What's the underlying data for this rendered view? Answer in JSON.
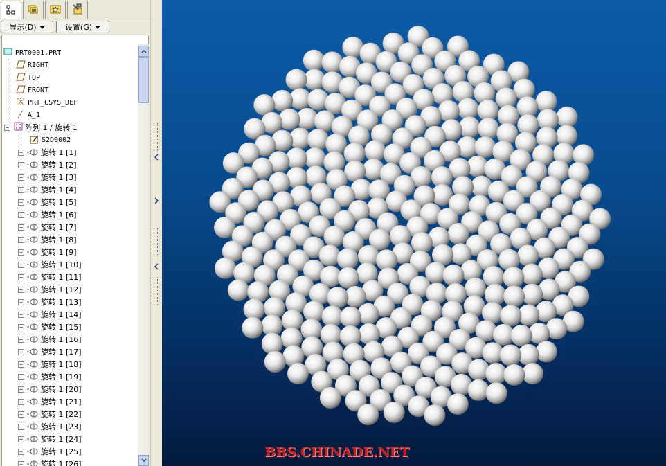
{
  "panel": {
    "tabs": [
      {
        "icon": "model-tree-icon",
        "active": true
      },
      {
        "icon": "folder-browser-icon",
        "active": false
      },
      {
        "icon": "favorites-icon",
        "active": false
      },
      {
        "icon": "connections-icon",
        "active": false
      }
    ],
    "show_menu": "显示(D)",
    "settings_menu": "设置(G)"
  },
  "tree": {
    "root": "PRT0001.PRT",
    "features": [
      {
        "label": "RIGHT",
        "icon": "datum-plane-icon"
      },
      {
        "label": "TOP",
        "icon": "datum-plane-icon"
      },
      {
        "label": "FRONT",
        "icon": "datum-plane-icon"
      },
      {
        "label": "PRT_CSYS_DEF",
        "icon": "csys-icon"
      },
      {
        "label": "A_1",
        "icon": "datum-axis-icon"
      }
    ],
    "pattern": {
      "label": "阵列 1 / 旋转 1",
      "sketch": "S2D0002",
      "items": [
        "旋转 1 [1]",
        "旋转 1 [2]",
        "旋转 1 [3]",
        "旋转 1 [4]",
        "旋转 1 [5]",
        "旋转 1 [6]",
        "旋转 1 [7]",
        "旋转 1 [8]",
        "旋转 1 [9]",
        "旋转 1 [10]",
        "旋转 1 [11]",
        "旋转 1 [12]",
        "旋转 1 [13]",
        "旋转 1 [14]",
        "旋转 1 [15]",
        "旋转 1 [16]",
        "旋转 1 [17]",
        "旋转 1 [18]",
        "旋转 1 [19]",
        "旋转 1 [20]",
        "旋转 1 [21]",
        "旋转 1 [22]",
        "旋转 1 [23]",
        "旋转 1 [24]",
        "旋转 1 [25]",
        "旋转 1 [26]"
      ]
    }
  },
  "viewport": {
    "background_top": "#0c5ca9",
    "background_bottom": "#031a3c",
    "model": "spherical balls arranged in a circular sunflower pattern",
    "watermark": "BBS.CHINADE.NET",
    "watermark_color": "#c02020"
  }
}
